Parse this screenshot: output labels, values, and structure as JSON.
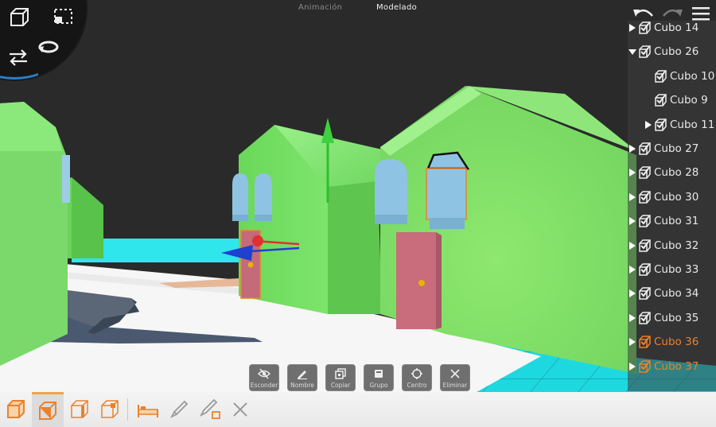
{
  "tabs": [
    {
      "label": "Animación",
      "active": false
    },
    {
      "label": "Modelado",
      "active": true
    }
  ],
  "tool_icons": [
    "cube-view-icon",
    "frame-selection-icon",
    "swap-arrows-icon",
    "rotate-icon"
  ],
  "top_right_icons": [
    "undo-icon",
    "redo-icon",
    "hamburger-menu-icon"
  ],
  "outliner": {
    "items": [
      {
        "label": "Cubo 14",
        "expander": "collapsed",
        "level": 0,
        "selected": false
      },
      {
        "label": "Cubo 26",
        "expander": "expanded",
        "level": 0,
        "selected": false
      },
      {
        "label": "Cubo 10",
        "expander": "none",
        "level": 1,
        "selected": false
      },
      {
        "label": "Cubo 9",
        "expander": "none",
        "level": 1,
        "selected": false
      },
      {
        "label": "Cubo 11",
        "expander": "collapsed",
        "level": 1,
        "selected": false
      },
      {
        "label": "Cubo 27",
        "expander": "collapsed",
        "level": 0,
        "selected": false
      },
      {
        "label": "Cubo 28",
        "expander": "collapsed",
        "level": 0,
        "selected": false
      },
      {
        "label": "Cubo 30",
        "expander": "collapsed",
        "level": 0,
        "selected": false
      },
      {
        "label": "Cubo 31",
        "expander": "collapsed",
        "level": 0,
        "selected": false
      },
      {
        "label": "Cubo 32",
        "expander": "collapsed",
        "level": 0,
        "selected": false
      },
      {
        "label": "Cubo 33",
        "expander": "collapsed",
        "level": 0,
        "selected": false
      },
      {
        "label": "Cubo 34",
        "expander": "collapsed",
        "level": 0,
        "selected": false
      },
      {
        "label": "Cubo 35",
        "expander": "collapsed",
        "level": 0,
        "selected": false
      },
      {
        "label": "Cubo 36",
        "expander": "collapsed",
        "level": 0,
        "selected": true
      },
      {
        "label": "Cubo 37",
        "expander": "collapsed",
        "level": 0,
        "selected": true
      }
    ],
    "accent_color": "#e9822c"
  },
  "actions": [
    {
      "label": "Esconder",
      "icon": "eye-slash-icon"
    },
    {
      "label": "Nombre",
      "icon": "pencil-icon"
    },
    {
      "label": "Copiar",
      "icon": "copy-icon"
    },
    {
      "label": "Grupo",
      "icon": "group-icon"
    },
    {
      "label": "Centro",
      "icon": "target-icon"
    },
    {
      "label": "Eliminar",
      "icon": "close-icon"
    }
  ],
  "bottom_tools": [
    {
      "name": "object-mode-icon",
      "active": false
    },
    {
      "name": "face-mode-icon",
      "active": true
    },
    {
      "name": "edge-mode-icon",
      "active": false
    },
    {
      "name": "vertex-mode-icon",
      "active": false
    },
    {
      "name": "bed-furniture-icon",
      "active": false
    },
    {
      "name": "brush-icon",
      "active": false
    },
    {
      "name": "paint-brush-icon",
      "active": false
    },
    {
      "name": "close-icon",
      "active": false
    }
  ],
  "colors": {
    "house_green": "#7ee06a",
    "door_pink": "#c46a78",
    "window_blue": "#8fc3e3",
    "water_cyan": "#2ee0e6",
    "floor_white": "#f5f5f5",
    "background": "#2a2a2a",
    "gizmo_x": "#e03030",
    "gizmo_y": "#2fbf2f",
    "gizmo_z": "#2040d0"
  }
}
